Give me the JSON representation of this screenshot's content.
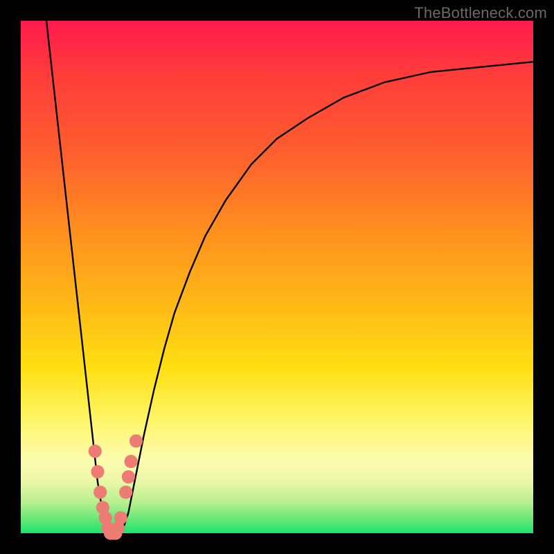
{
  "watermark": "TheBottleneck.com",
  "chart_data": {
    "type": "line",
    "title": "",
    "xlabel": "",
    "ylabel": "",
    "xlim": [
      0,
      100
    ],
    "ylim": [
      0,
      100
    ],
    "grid": false,
    "legend": false,
    "background_gradient": {
      "orientation": "vertical",
      "stops": [
        {
          "pos": 0.0,
          "color": "#ff1a4d"
        },
        {
          "pos": 0.4,
          "color": "#ff8c1f"
        },
        {
          "pos": 0.68,
          "color": "#ffe012"
        },
        {
          "pos": 0.86,
          "color": "#fcfcb0"
        },
        {
          "pos": 1.0,
          "color": "#1be36b"
        }
      ]
    },
    "series": [
      {
        "name": "bottleneck-curve",
        "color": "#000000",
        "x": [
          5,
          6,
          7,
          8,
          9,
          10,
          11,
          12,
          13,
          14,
          15,
          16,
          17,
          18,
          19,
          20,
          21,
          22,
          23,
          24,
          26,
          28,
          30,
          33,
          36,
          40,
          45,
          50,
          56,
          63,
          71,
          80,
          90,
          100
        ],
        "y": [
          100,
          91,
          82,
          73,
          64,
          55,
          46,
          37,
          28,
          19,
          10,
          4,
          1,
          0,
          0,
          1,
          4,
          9,
          14,
          19,
          28,
          36,
          43,
          51,
          58,
          65,
          72,
          77,
          81,
          85,
          88,
          90,
          91,
          92
        ]
      }
    ],
    "markers": [
      {
        "name": "highlight-dots",
        "color": "#ed7c75",
        "radius": 3.2,
        "points": [
          {
            "x": 14.5,
            "y": 16
          },
          {
            "x": 15.0,
            "y": 12
          },
          {
            "x": 15.5,
            "y": 8
          },
          {
            "x": 16.0,
            "y": 5
          },
          {
            "x": 16.5,
            "y": 3
          },
          {
            "x": 17.0,
            "y": 1
          },
          {
            "x": 17.5,
            "y": 0
          },
          {
            "x": 18.0,
            "y": 0
          },
          {
            "x": 18.5,
            "y": 0
          },
          {
            "x": 19.0,
            "y": 1
          },
          {
            "x": 19.5,
            "y": 3
          },
          {
            "x": 20.5,
            "y": 8
          },
          {
            "x": 21.0,
            "y": 11
          },
          {
            "x": 21.5,
            "y": 14
          },
          {
            "x": 22.5,
            "y": 18
          }
        ]
      }
    ]
  }
}
